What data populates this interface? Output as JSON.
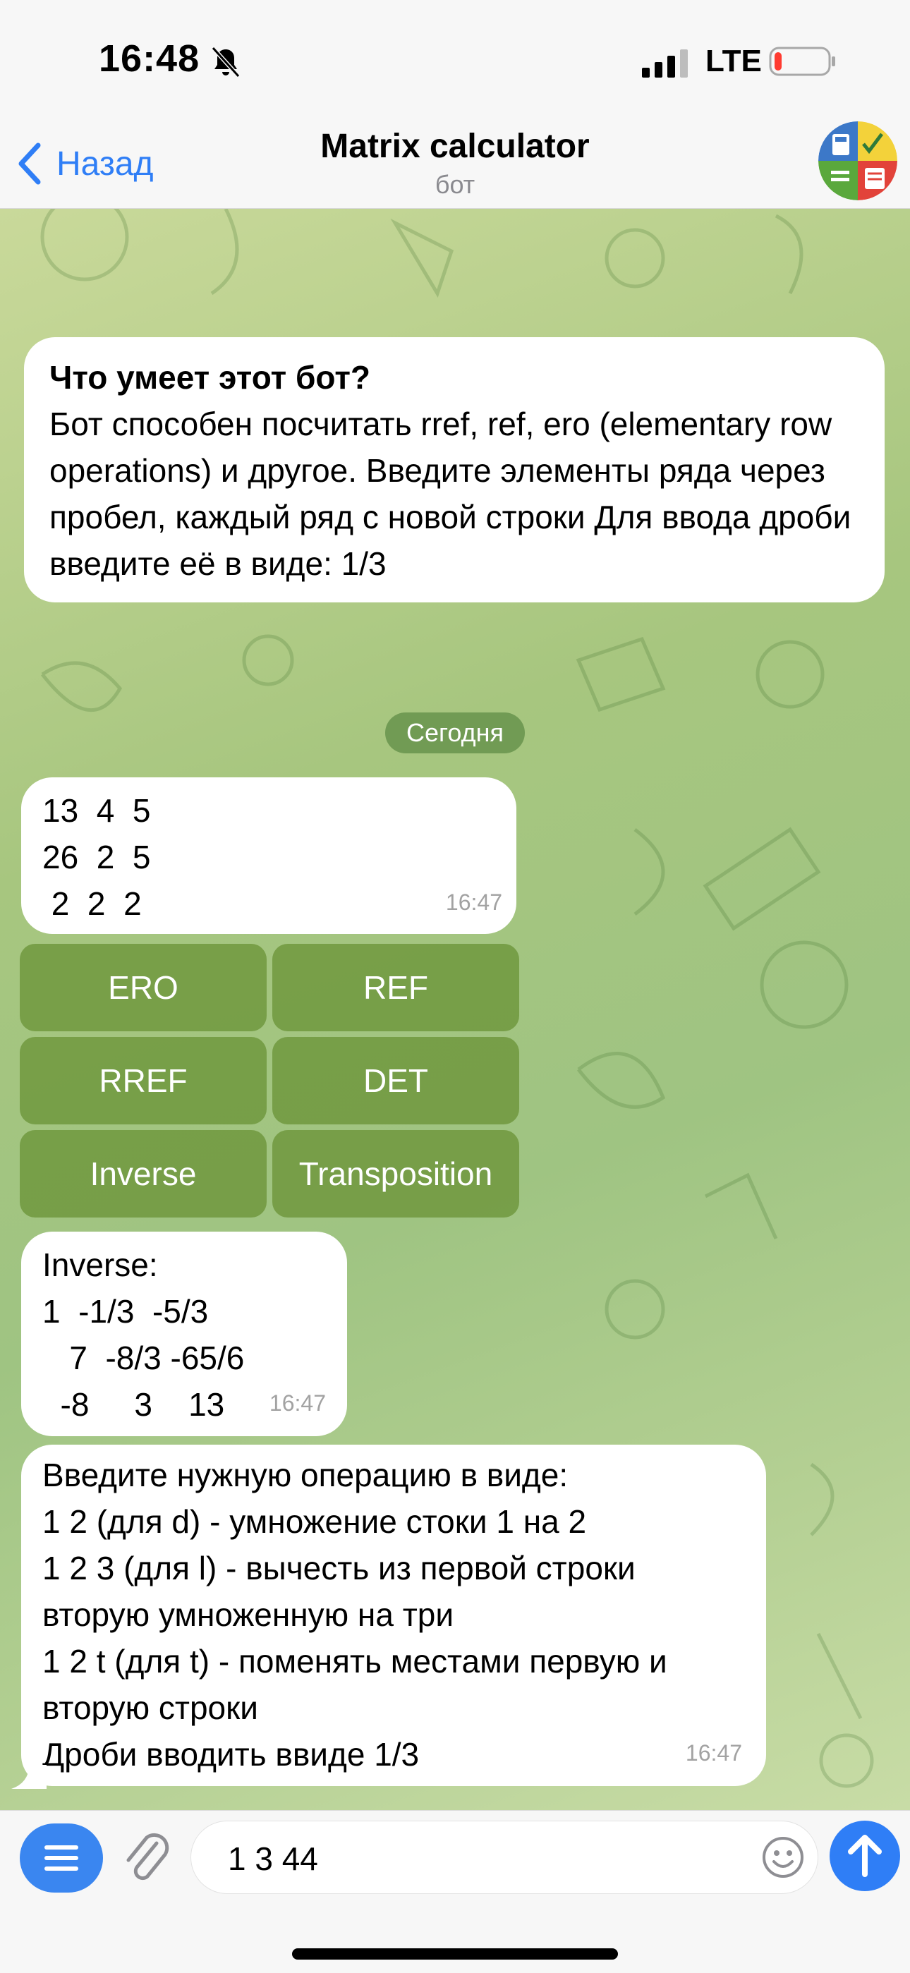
{
  "status_bar": {
    "time": "16:48",
    "network": "LTE",
    "battery_level": 0.12,
    "icons": [
      "bell-slash-icon",
      "signal-icon",
      "battery-icon"
    ]
  },
  "header": {
    "back_label": "Назад",
    "title": "Matrix calculator",
    "subtitle": "бот"
  },
  "intro": {
    "heading": "Что умеет этот бот?",
    "body": "Бот способен посчитать rref, ref, ero (elementary row operations) и другое. Введите элементы ряда через пробел, каждый ряд с новой строки Для ввода дроби введите её в виде: 1/3"
  },
  "day_separator": "Сегодня",
  "messages": [
    {
      "text": "13  4  5\n26  2  5\n 2  2  2",
      "time": "16:47"
    },
    {
      "text": "Inverse:\n1  -1/3  -5/3\n   7  -8/3 -65/6\n  -8     3    13",
      "time": "16:47"
    },
    {
      "text": "Введите нужную операцию в виде:\n1 2 (для d) - умножение стоки 1 на 2\n1 2 3 (для l) - вычесть из первой строки\nвторую умноженную на три\n1 2 t (для t) - поменять местами первую и\nвторую строки\nДроби вводить ввиде 1/3",
      "time": "16:47"
    }
  ],
  "keyboard": {
    "buttons": [
      "ERO",
      "REF",
      "RREF",
      "DET",
      "Inverse",
      "Transposition"
    ]
  },
  "input": {
    "value": "1 3 44"
  },
  "colors": {
    "accent": "#2f7ef6",
    "keyboard_button": "#6e963c"
  }
}
